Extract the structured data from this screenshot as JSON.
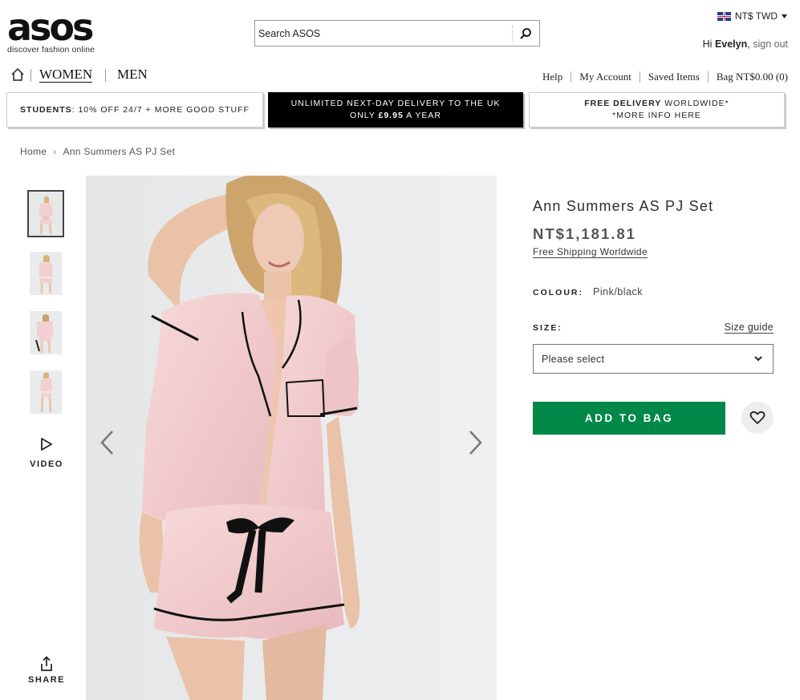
{
  "header": {
    "logo_text": "asos",
    "logo_tagline": "discover fashion online",
    "search_placeholder": "Search ASOS",
    "currency": "NT$ TWD",
    "greeting_prefix": "Hi",
    "user_name": "Evelyn",
    "sign_out": "sign out"
  },
  "nav": {
    "women": "WOMEN",
    "men": "MEN",
    "links": {
      "help": "Help",
      "account": "My Account",
      "saved": "Saved Items",
      "bag": "Bag NT$0.00 (0)"
    }
  },
  "promos": {
    "p1_bold": "STUDENTS",
    "p1_rest": ": 10% OFF 24/7 + MORE GOOD STUFF",
    "p2_line1": "UNLIMITED NEXT-DAY DELIVERY TO THE UK",
    "p2_line2_pre": "ONLY ",
    "p2_line2_bold": "£9.95",
    "p2_line2_post": " A YEAR",
    "p3_bold": "FREE DELIVERY",
    "p3_rest": " WORLDWIDE*",
    "p3_line2": "*MORE INFO HERE"
  },
  "breadcrumb": {
    "home": "Home",
    "separator": "›",
    "current": "Ann Summers AS PJ Set"
  },
  "gallery": {
    "video_label": "VIDEO",
    "share_label": "SHARE",
    "icons": [
      "play-icon",
      "share-icon",
      "chevron-left-icon",
      "chevron-right-icon"
    ]
  },
  "product": {
    "title": "Ann Summers AS PJ Set",
    "price": "NT$1,181.81",
    "shipping": "Free Shipping Worldwide",
    "colour_label": "COLOUR:",
    "colour_value": "Pink/black",
    "size_label": "SIZE:",
    "size_guide": "Size guide",
    "size_select": "Please select",
    "add_to_bag": "ADD TO BAG"
  },
  "colors": {
    "add_to_bag_green": "#018849",
    "promo_black": "#000000",
    "pyjama_pink": "#f2cfd0"
  }
}
